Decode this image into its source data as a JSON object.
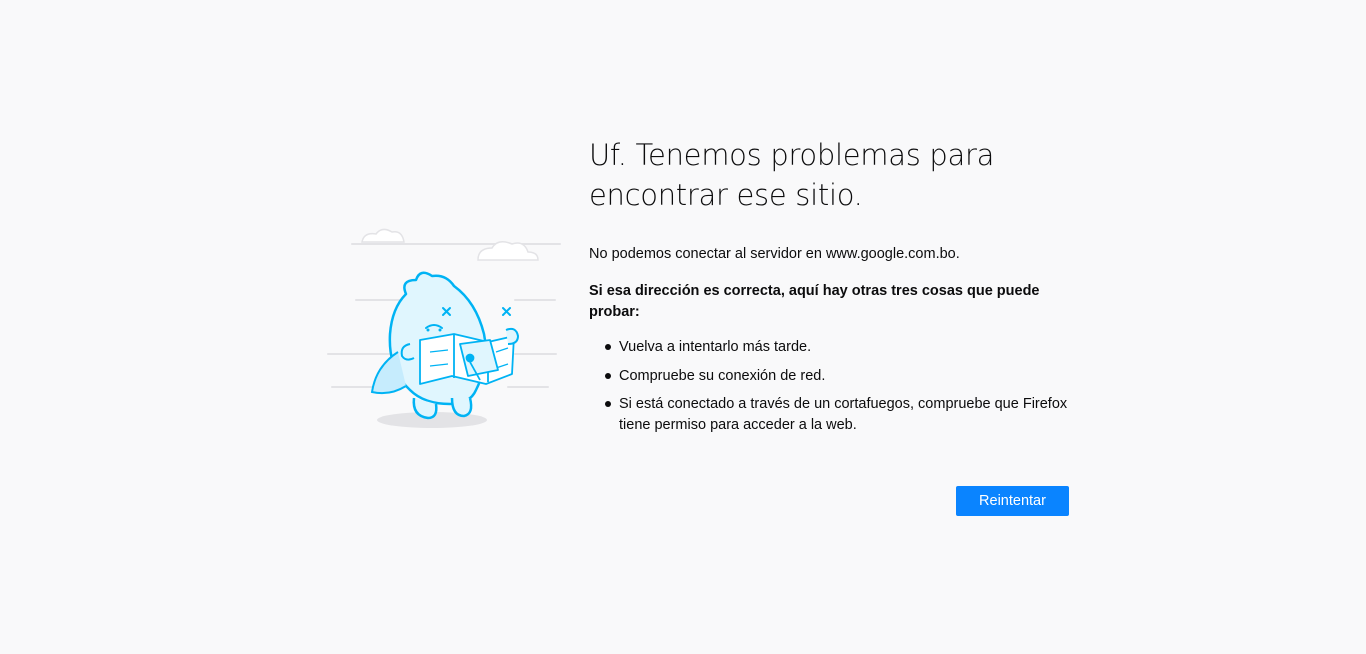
{
  "error_page": {
    "title_line1": "Uf. Tenemos problemas para",
    "title_line2": "encontrar ese sitio.",
    "description": "No podemos conectar al servidor en www.google.com.bo.",
    "advice_heading": "Si esa dirección es correcta, aquí hay otras tres cosas que puede probar:",
    "tips": [
      "Vuelva a intentarlo más tarde.",
      "Compruebe su conexión de red.",
      "Si está conectado a través de un cortafuegos, compruebe que Firefox tiene permiso para acceder a la web."
    ],
    "retry_label": "Reintentar",
    "illustration_icon": "confused-monster-with-map-icon"
  },
  "colors": {
    "background": "#f9f9fa",
    "text": "#0c0c0d",
    "accent": "#0a84ff",
    "illustration_stroke": "#00b3f4",
    "illustration_fill": "#e0f6fe"
  }
}
